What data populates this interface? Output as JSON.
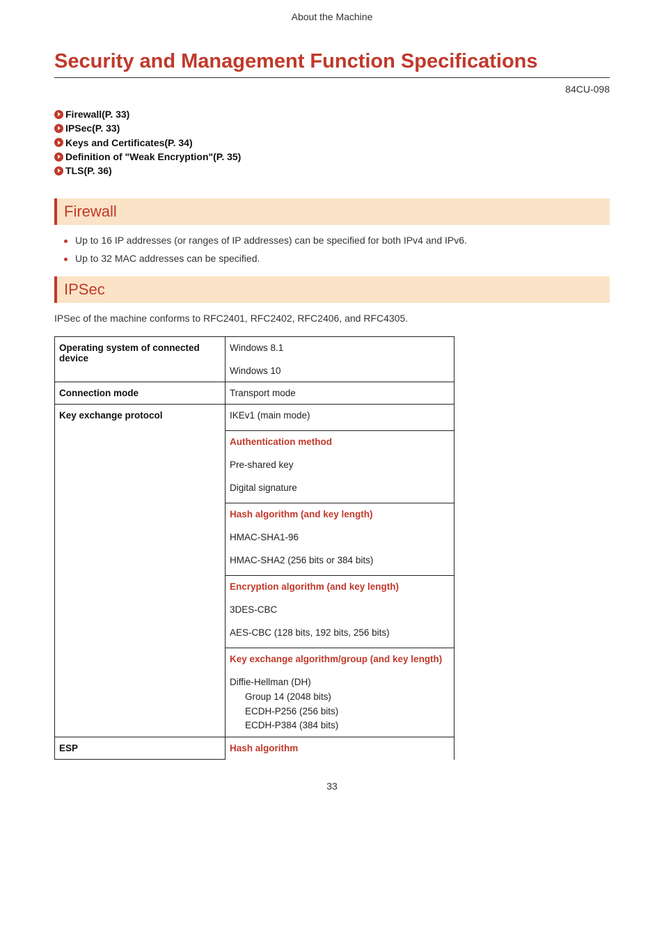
{
  "header": "About the Machine",
  "title": "Security and Management Function Specifications",
  "doc_code": "84CU-098",
  "toc": [
    "Firewall(P. 33)",
    "IPSec(P. 33)",
    "Keys and Certificates(P. 34)",
    "Definition of \"Weak Encryption\"(P. 35)",
    "TLS(P. 36)"
  ],
  "firewall": {
    "heading": "Firewall",
    "bullets": [
      "Up to 16 IP addresses (or ranges of IP addresses) can be specified for both IPv4 and IPv6.",
      "Up to 32 MAC addresses can be specified."
    ]
  },
  "ipsec": {
    "heading": "IPSec",
    "intro": "IPSec of the machine conforms to RFC2401, RFC2402, RFC2406, and RFC4305.",
    "rows": {
      "os": {
        "label": "Operating system of connected device",
        "v1": "Windows 8.1",
        "v2": "Windows 10"
      },
      "conn": {
        "label": "Connection mode",
        "value": "Transport mode"
      },
      "kex": {
        "label": "Key exchange protocol",
        "top": "IKEv1 (main mode)",
        "auth_h": "Authentication method",
        "auth_1": "Pre-shared key",
        "auth_2": "Digital signature",
        "hash_h": "Hash algorithm (and key length)",
        "hash_1": "HMAC-SHA1-96",
        "hash_2": "HMAC-SHA2 (256 bits or 384 bits)",
        "enc_h": "Encryption algorithm (and key length)",
        "enc_1": "3DES-CBC",
        "enc_2": "AES-CBC (128 bits, 192 bits, 256 bits)",
        "keg_h": "Key exchange algorithm/group (and key length)",
        "keg_top": "Diffie-Hellman (DH)",
        "keg_s1": "Group 14 (2048 bits)",
        "keg_s2": "ECDH-P256 (256 bits)",
        "keg_s3": "ECDH-P384 (384 bits)"
      },
      "esp": {
        "label": "ESP",
        "hash_h": "Hash algorithm"
      }
    }
  },
  "page_number": "33"
}
